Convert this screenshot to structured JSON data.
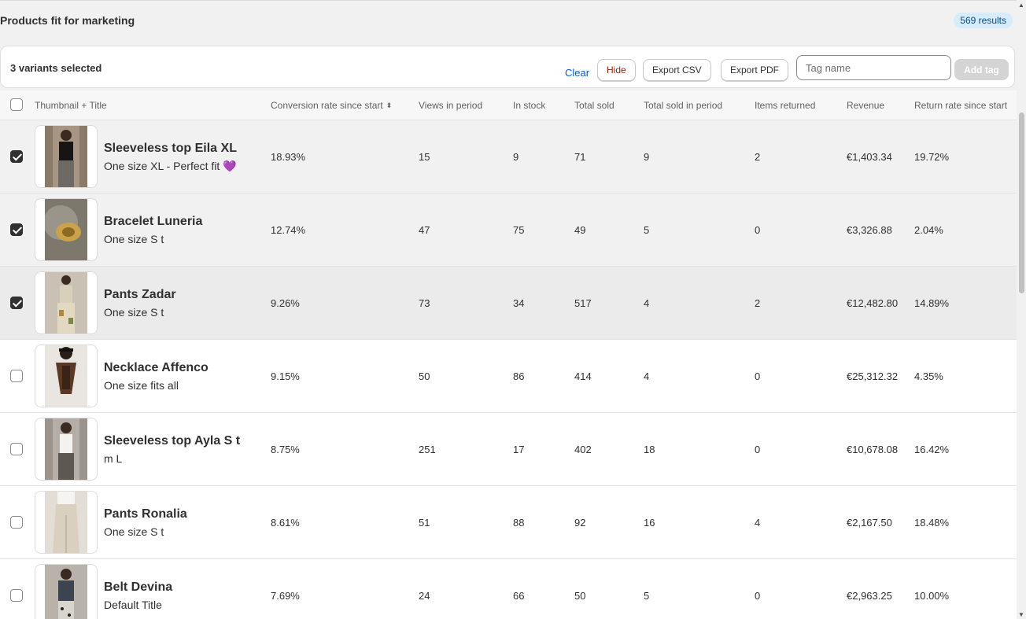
{
  "header": {
    "title": "Products fit for marketing",
    "results_badge": "569 results"
  },
  "toolbar": {
    "selected_count": "3 variants selected",
    "clear_label": "Clear",
    "hide_label": "Hide",
    "export_csv_label": "Export CSV",
    "export_pdf_label": "Export PDF",
    "tag_placeholder": "Tag name",
    "tag_value": "",
    "add_tag_label": "Add tag"
  },
  "table": {
    "columns": [
      "Thumbnail + Title",
      "Conversion rate since start",
      "Views in period",
      "In stock",
      "Total sold",
      "Total sold in period",
      "Items returned",
      "Revenue",
      "Return rate since start"
    ],
    "sorted_column": "Conversion rate since start",
    "rows": [
      {
        "selected": true,
        "title": "Sleeveless top Eila XL",
        "variant": "One size XL - Perfect fit 💜",
        "conversion": "18.93%",
        "views": "15",
        "stock": "9",
        "sold": "71",
        "sold_period": "9",
        "returned": "2",
        "revenue": "€1,403.34",
        "return_rate": "19.72%"
      },
      {
        "selected": true,
        "title": "Bracelet Luneria",
        "variant": "One size S t",
        "conversion": "12.74%",
        "views": "47",
        "stock": "75",
        "sold": "49",
        "sold_period": "5",
        "returned": "0",
        "revenue": "€3,326.88",
        "return_rate": "2.04%"
      },
      {
        "selected": true,
        "title": "Pants Zadar",
        "variant": "One size S t",
        "conversion": "9.26%",
        "views": "73",
        "stock": "34",
        "sold": "517",
        "sold_period": "4",
        "returned": "2",
        "revenue": "€12,482.80",
        "return_rate": "14.89%"
      },
      {
        "selected": false,
        "title": "Necklace Affenco",
        "variant": "One size fits all",
        "conversion": "9.15%",
        "views": "50",
        "stock": "86",
        "sold": "414",
        "sold_period": "4",
        "returned": "0",
        "revenue": "€25,312.32",
        "return_rate": "4.35%"
      },
      {
        "selected": false,
        "title": "Sleeveless top Ayla S t",
        "variant": "m L",
        "conversion": "8.75%",
        "views": "251",
        "stock": "17",
        "sold": "402",
        "sold_period": "18",
        "returned": "0",
        "revenue": "€10,678.08",
        "return_rate": "16.42%"
      },
      {
        "selected": false,
        "title": "Pants Ronalia",
        "variant": "One size S t",
        "conversion": "8.61%",
        "views": "51",
        "stock": "88",
        "sold": "92",
        "sold_period": "16",
        "returned": "4",
        "revenue": "€2,167.50",
        "return_rate": "18.48%"
      },
      {
        "selected": false,
        "title": "Belt Devina",
        "variant": "Default Title",
        "conversion": "7.69%",
        "views": "24",
        "stock": "66",
        "sold": "50",
        "sold_period": "5",
        "returned": "0",
        "revenue": "€2,963.25",
        "return_rate": "10.00%"
      }
    ]
  },
  "colors": {
    "accent_link": "#005bd3",
    "hide_text": "#8e1f0b",
    "badge_bg": "#d7ecfb",
    "selected_row": "#f1f1f1"
  }
}
